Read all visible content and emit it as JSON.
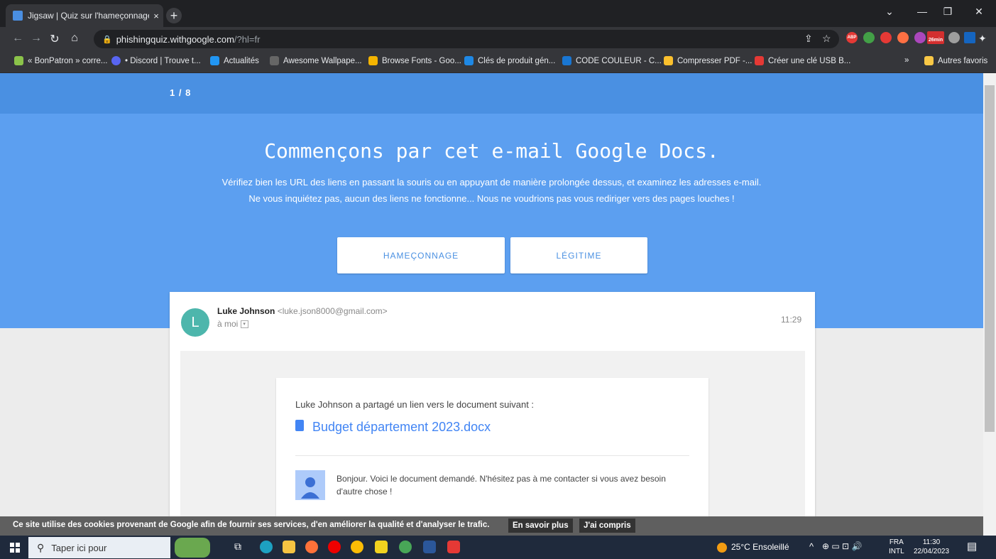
{
  "tab": {
    "title": "Jigsaw | Quiz sur l'hameçonnage",
    "close": "×",
    "new": "+"
  },
  "window": {
    "minimize": "—",
    "restore": "❐",
    "close": "✕",
    "tabs_menu": "⌄"
  },
  "omnibox": {
    "host": "phishingquiz.withgoogle.com",
    "path": "/?hl=fr"
  },
  "extensions": {
    "abp": "ABP",
    "timer": "26min"
  },
  "bookmarks": [
    {
      "label": "« BonPatron » corre...",
      "color": "#8bc34a"
    },
    {
      "label": "• Discord | Trouve t...",
      "color": "#5865f2"
    },
    {
      "label": "Actualités",
      "color": "#2196f3"
    },
    {
      "label": "Awesome Wallpape...",
      "color": "#666666"
    },
    {
      "label": "Browse Fonts - Goo...",
      "color": "#f4b400"
    },
    {
      "label": "Clés de produit gén...",
      "color": "#1e88e5"
    },
    {
      "label": "CODE COULEUR - C...",
      "color": "#1976d2"
    },
    {
      "label": "Compresser PDF -...",
      "color": "#fbc02d"
    },
    {
      "label": "Créer une clé USB B...",
      "color": "#e53935"
    }
  ],
  "bookmarks_more": "»",
  "bookmarks_other": "Autres favoris",
  "quiz": {
    "counter": "1 / 8",
    "heading": "Commençons par cet e-mail Google Docs.",
    "intro": "Vérifiez bien les URL des liens en passant la souris ou en appuyant de manière prolongée dessus, et examinez les adresses e-mail. Ne vous inquiétez pas, aucun des liens ne fonctionne... Nous ne voudrions pas vous rediriger vers des pages louches !",
    "phishing_label": "HAMEÇONNAGE",
    "legit_label": "LÉGITIME"
  },
  "email": {
    "avatar_letter": "L",
    "sender_name": "Luke Johnson",
    "sender_email": "<luke.json8000@gmail.com>",
    "recipient": "à moi",
    "time": "11:29",
    "share_text": "Luke Johnson a partagé un lien vers le document suivant :",
    "doc_name": "Budget département 2023.docx",
    "message": "Bonjour. Voici le document demandé. N'hésitez pas à me contacter si vous avez besoin d'autre chose !"
  },
  "cookie": {
    "text": "Ce site utilise des cookies provenant de Google afin de fournir ses services, d'en améliorer la qualité et d'analyser le trafic.",
    "learn_more": "En savoir plus",
    "accept": "J'ai compris"
  },
  "taskbar": {
    "search_placeholder": "Taper ici pour",
    "weather": "25°C Ensoleillé",
    "lang_top": "FRA",
    "lang_bottom": "INTL",
    "time": "11:30",
    "date": "22/04/2023"
  }
}
